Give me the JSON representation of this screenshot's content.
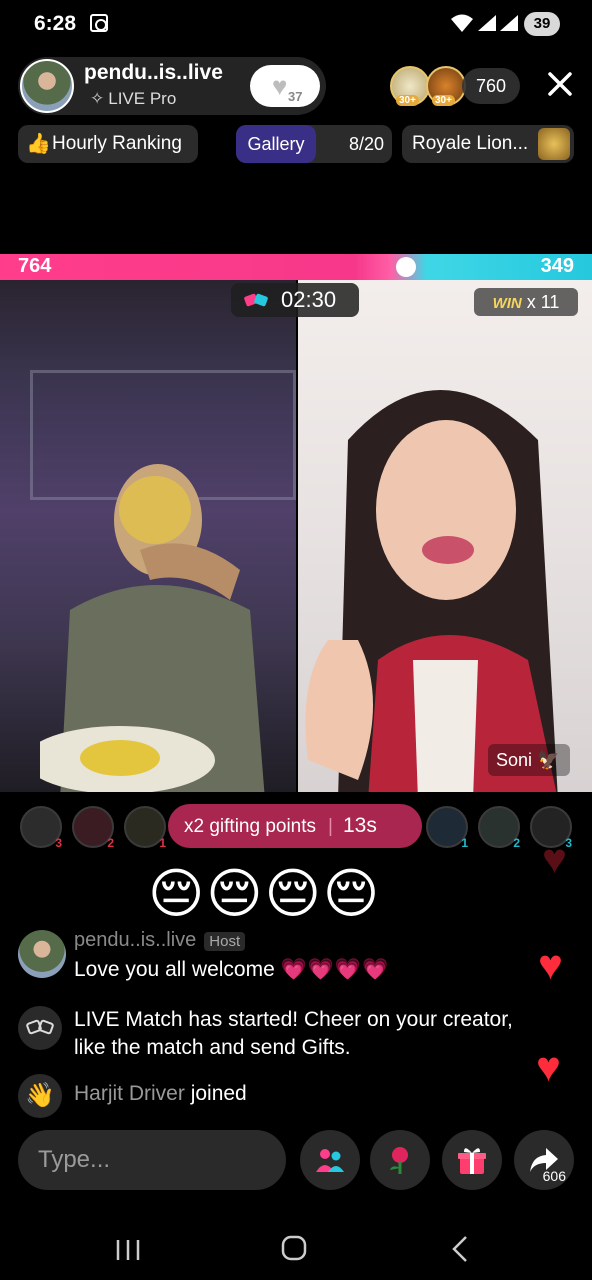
{
  "status_bar": {
    "time": "6:28",
    "battery": "39"
  },
  "host": {
    "name": "pendu..is..live",
    "subtitle": "LIVE Pro",
    "follow_count": "37"
  },
  "viewers": {
    "badges": [
      "30+",
      "30+"
    ],
    "count": "760"
  },
  "chips": {
    "ranking": "Hourly Ranking",
    "gallery_label": "Gallery",
    "gallery_count": "8/20",
    "lion": "Royale Lion..."
  },
  "battle": {
    "left_score": "764",
    "right_score": "349",
    "timer": "02:30",
    "win_label": "WIN",
    "win_count": "x 11",
    "opponent_tag": "Soni"
  },
  "contributors": {
    "ranks": [
      "3",
      "2",
      "1",
      "1",
      "2",
      "3"
    ]
  },
  "gifting": {
    "label": "x2 gifting points",
    "seconds": "13s"
  },
  "emojis": "😔😔😔😔",
  "chat": [
    {
      "user": "pendu..is..live",
      "badge": "Host",
      "text": "Love you all welcome",
      "hearts": "💗💗💗💗"
    },
    {
      "text": "LIVE Match has started! Cheer on your creator, like the match and send Gifts."
    },
    {
      "user": "Harjit Driver",
      "text": "joined"
    }
  ],
  "input": {
    "placeholder": "Type..."
  },
  "actions": {
    "share_count": "606"
  }
}
